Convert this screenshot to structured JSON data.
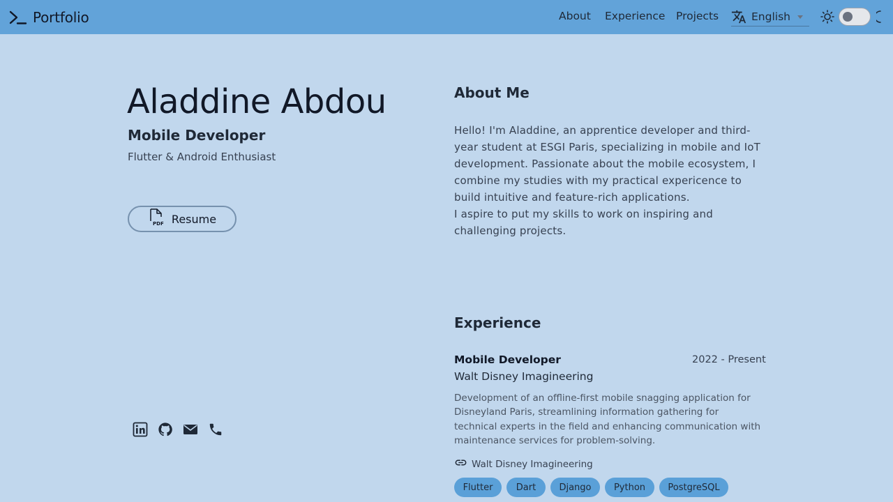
{
  "header": {
    "brand": "Portfolio",
    "nav": [
      {
        "label": "About"
      },
      {
        "label": "Experience"
      },
      {
        "label": "Projects"
      }
    ],
    "language": "English",
    "theme_toggle": {
      "dark_mode": false
    }
  },
  "profile": {
    "name": "Aladdine Abdou",
    "role": "Mobile Developer",
    "tagline": "Flutter & Android Enthusiast",
    "resume_label": "Resume",
    "socials": [
      "linkedin-icon",
      "github-icon",
      "email-icon",
      "phone-icon"
    ]
  },
  "about": {
    "title": "About Me",
    "paragraphs": [
      "Hello! I'm Aladdine, an apprentice developer and third-year student at ESGI Paris, specializing in mobile and IoT development. Passionate about the mobile ecosystem, I combine my studies with my practical expericence to build intuitive and feature-rich applications.",
      "I aspire to put my skills to work on inspiring and challenging projects."
    ]
  },
  "experience": {
    "title": "Experience",
    "items": [
      {
        "role": "Mobile Developer",
        "dates": "2022 - Present",
        "company": "Walt Disney Imagineering",
        "description": "Development of an offline-first mobile snagging application for Disneyland Paris, streamlining information gathering for technical experts in the field and enhancing communication with maintenance services for problem-solving.",
        "link_label": "Walt Disney Imagineering",
        "tags": [
          "Flutter",
          "Dart",
          "Django",
          "Python",
          "PostgreSQL"
        ]
      }
    ]
  },
  "colors": {
    "background": "#c1d7ed",
    "header": "#62a3d9",
    "tag": "#5aa0d8"
  }
}
